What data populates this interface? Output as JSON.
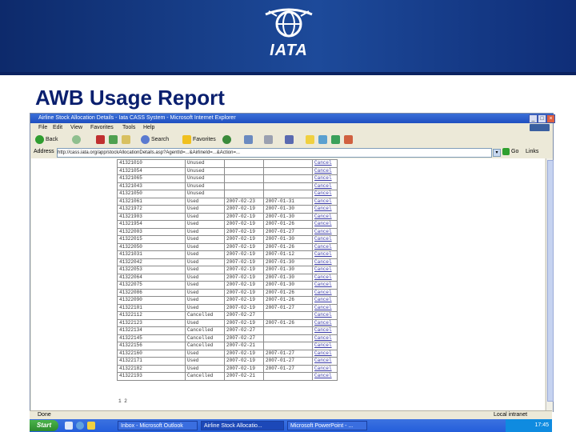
{
  "slide": {
    "title": "AWB Usage Report",
    "logo_text": "IATA",
    "colors": {
      "banner": "#1d4a9a",
      "title": "#0a1f6e"
    }
  },
  "window": {
    "title": "Airline Stock Allocation Details - Iata CASS System - Microsoft Internet Explorer",
    "menu": [
      "File",
      "Edit",
      "View",
      "Favorites",
      "Tools",
      "Help"
    ],
    "toolbar": {
      "back": "Back",
      "search": "Search",
      "favorites": "Favorites"
    },
    "address_label": "Address",
    "address_value": "http://cass.iata.org/app/stockAllocationDetails.asp?AgentId=...&AirlineId=...&Action=...",
    "go": "Go",
    "links": "Links"
  },
  "report": {
    "rows": [
      {
        "awb": "41321010",
        "status": "Unused",
        "date1": "",
        "date2": "",
        "action": "Cancel"
      },
      {
        "awb": "41321054",
        "status": "Unused",
        "date1": "",
        "date2": "",
        "action": "Cancel"
      },
      {
        "awb": "41321065",
        "status": "Unused",
        "date1": "",
        "date2": "",
        "action": "Cancel"
      },
      {
        "awb": "41321043",
        "status": "Unused",
        "date1": "",
        "date2": "",
        "action": "Cancel"
      },
      {
        "awb": "41321050",
        "status": "Unused",
        "date1": "",
        "date2": "",
        "action": "Cancel"
      },
      {
        "awb": "41321061",
        "status": "Used",
        "date1": "2007-02-23",
        "date2": "2007-01-31",
        "action": "Cancel"
      },
      {
        "awb": "41321972",
        "status": "Used",
        "date1": "2007-02-19",
        "date2": "2007-01-30",
        "action": "Cancel"
      },
      {
        "awb": "41321903",
        "status": "Used",
        "date1": "2007-02-19",
        "date2": "2007-01-30",
        "action": "Cancel"
      },
      {
        "awb": "41321954",
        "status": "Used",
        "date1": "2007-02-19",
        "date2": "2007-01-26",
        "action": "Cancel"
      },
      {
        "awb": "41322003",
        "status": "Used",
        "date1": "2007-02-19",
        "date2": "2007-01-27",
        "action": "Cancel"
      },
      {
        "awb": "41322015",
        "status": "Used",
        "date1": "2007-02-19",
        "date2": "2007-01-30",
        "action": "Cancel"
      },
      {
        "awb": "41322050",
        "status": "Used",
        "date1": "2007-02-19",
        "date2": "2007-01-26",
        "action": "Cancel"
      },
      {
        "awb": "41321031",
        "status": "Used",
        "date1": "2007-02-19",
        "date2": "2007-01-12",
        "action": "Cancel"
      },
      {
        "awb": "41322042",
        "status": "Used",
        "date1": "2007-02-19",
        "date2": "2007-01-30",
        "action": "Cancel"
      },
      {
        "awb": "41322053",
        "status": "Used",
        "date1": "2007-02-19",
        "date2": "2007-01-30",
        "action": "Cancel"
      },
      {
        "awb": "41322064",
        "status": "Used",
        "date1": "2007-02-19",
        "date2": "2007-01-30",
        "action": "Cancel"
      },
      {
        "awb": "41322075",
        "status": "Used",
        "date1": "2007-02-19",
        "date2": "2007-01-30",
        "action": "Cancel"
      },
      {
        "awb": "41322086",
        "status": "Used",
        "date1": "2007-02-19",
        "date2": "2007-01-26",
        "action": "Cancel"
      },
      {
        "awb": "41322090",
        "status": "Used",
        "date1": "2007-02-19",
        "date2": "2007-01-26",
        "action": "Cancel"
      },
      {
        "awb": "41322101",
        "status": "Used",
        "date1": "2007-02-19",
        "date2": "2007-01-27",
        "action": "Cancel"
      },
      {
        "awb": "41322112",
        "status": "Cancelled",
        "date1": "2007-02-27",
        "date2": "",
        "action": "Cancel"
      },
      {
        "awb": "41322123",
        "status": "Used",
        "date1": "2007-02-19",
        "date2": "2007-01-26",
        "action": "Cancel"
      },
      {
        "awb": "41322134",
        "status": "Cancelled",
        "date1": "2007-02-27",
        "date2": "",
        "action": "Cancel"
      },
      {
        "awb": "41322145",
        "status": "Cancelled",
        "date1": "2007-02-27",
        "date2": "",
        "action": "Cancel"
      },
      {
        "awb": "41322156",
        "status": "Cancelled",
        "date1": "2007-02-21",
        "date2": "",
        "action": "Cancel"
      },
      {
        "awb": "41322160",
        "status": "Used",
        "date1": "2007-02-19",
        "date2": "2007-01-27",
        "action": "Cancel"
      },
      {
        "awb": "41322171",
        "status": "Used",
        "date1": "2007-02-19",
        "date2": "2007-01-27",
        "action": "Cancel"
      },
      {
        "awb": "41322182",
        "status": "Used",
        "date1": "2007-02-19",
        "date2": "2007-01-27",
        "action": "Cancel"
      },
      {
        "awb": "41322193",
        "status": "Cancelled",
        "date1": "2007-02-21",
        "date2": "",
        "action": "Cancel"
      }
    ],
    "tail": "1 2"
  },
  "status": {
    "text": "Done",
    "zone": "Local intranet"
  },
  "taskbar": {
    "start": "Start",
    "tasks": [
      "Inbox - Microsoft Outlook",
      "Airline Stock Allocatio...",
      "Microsoft PowerPoint - ..."
    ],
    "clock": "17:45"
  }
}
